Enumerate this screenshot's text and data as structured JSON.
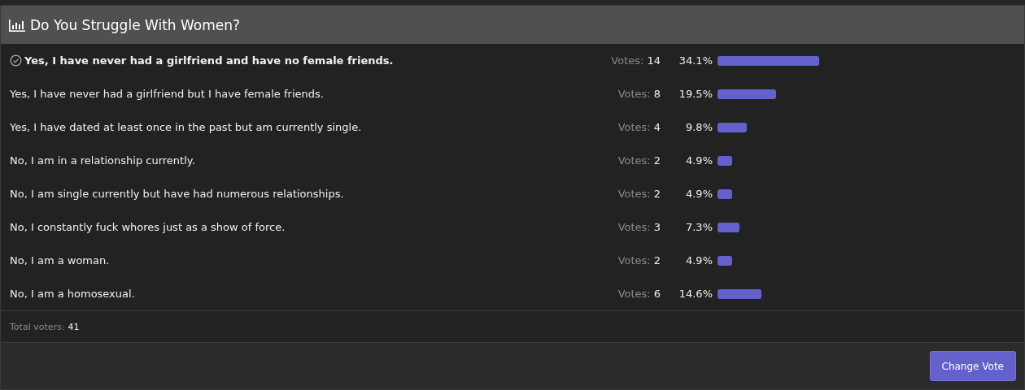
{
  "poll": {
    "title": "Do You Struggle With Women?",
    "options": [
      {
        "label": "Yes, I have never had a girlfriend and have no female friends.",
        "selected": true,
        "votes_label": "Votes:",
        "votes": "14",
        "percent": "34.1%"
      },
      {
        "label": "Yes, I have never had a girlfriend but I have female friends.",
        "selected": false,
        "votes_label": "Votes:",
        "votes": "8",
        "percent": "19.5%"
      },
      {
        "label": "Yes, I have dated at least once in the past but am currently single.",
        "selected": false,
        "votes_label": "Votes:",
        "votes": "4",
        "percent": "9.8%"
      },
      {
        "label": "No, I am in a relationship currently.",
        "selected": false,
        "votes_label": "Votes:",
        "votes": "2",
        "percent": "4.9%"
      },
      {
        "label": "No, I am single currently but have had numerous relationships.",
        "selected": false,
        "votes_label": "Votes:",
        "votes": "2",
        "percent": "4.9%"
      },
      {
        "label": "No, I constantly fuck whores just as a show of force.",
        "selected": false,
        "votes_label": "Votes:",
        "votes": "3",
        "percent": "7.3%"
      },
      {
        "label": "No, I am a woman.",
        "selected": false,
        "votes_label": "Votes:",
        "votes": "2",
        "percent": "4.9%"
      },
      {
        "label": "No, I am a homosexual.",
        "selected": false,
        "votes_label": "Votes:",
        "votes": "6",
        "percent": "14.6%"
      }
    ],
    "total_label": "Total voters:",
    "total": "41",
    "button": "Change Vote"
  }
}
